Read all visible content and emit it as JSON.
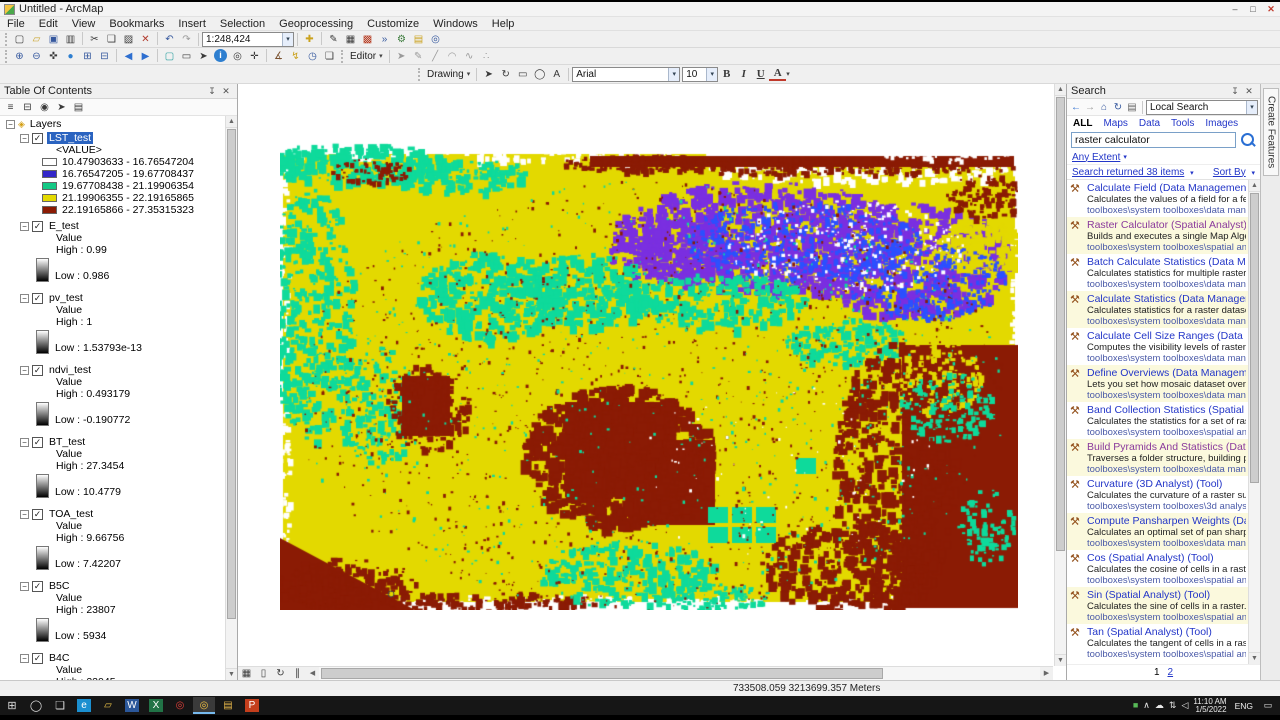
{
  "window": {
    "title": "Untitled - ArcMap",
    "controls": {
      "minimize": "–",
      "maximize": "□",
      "close": "✕"
    }
  },
  "ui": {
    "caret": "▾",
    "close": "✕",
    "pin": "↧",
    "check": "✓",
    "collapse": "−",
    "tool_glyph": "⚒",
    "arrow_left": "◀",
    "arrow_right": "▶",
    "arrow_up": "▲",
    "arrow_down": "▼",
    "layers_glyph": "◈"
  },
  "menubar": [
    "File",
    "Edit",
    "View",
    "Bookmarks",
    "Insert",
    "Selection",
    "Geoprocessing",
    "Customize",
    "Windows",
    "Help"
  ],
  "toolbars": {
    "scale_value": "1:248,424",
    "standard_left": [
      {
        "name": "new-map-icon",
        "glyph": "▢"
      },
      {
        "name": "open-icon",
        "glyph": "▱",
        "fg": "#c9a227"
      },
      {
        "name": "save-icon",
        "glyph": "▣",
        "fg": "#35589e"
      },
      {
        "name": "print-icon",
        "glyph": "▥"
      },
      {
        "sep": true
      },
      {
        "name": "cut-icon",
        "glyph": "✂"
      },
      {
        "name": "copy-icon",
        "glyph": "❑"
      },
      {
        "name": "paste-icon",
        "glyph": "▨"
      },
      {
        "name": "delete-icon",
        "glyph": "✕",
        "fg": "#b23b2e"
      },
      {
        "sep": true
      },
      {
        "name": "undo-icon",
        "glyph": "↶",
        "fg": "#35589e"
      },
      {
        "name": "redo-icon",
        "glyph": "↷",
        "fg": "#9a9a9a"
      }
    ],
    "standard_right": [
      {
        "name": "add-data-icon",
        "glyph": "✚",
        "fg": "#caa21e"
      },
      {
        "sep": true
      },
      {
        "name": "editor-toolbar-toggle-icon",
        "glyph": "✎"
      },
      {
        "name": "table-options-icon",
        "glyph": "▦"
      },
      {
        "name": "arctoolbox-icon",
        "glyph": "▩",
        "fg": "#b5391f"
      },
      {
        "name": "python-window-icon",
        "glyph": "»",
        "fg": "#35589e"
      },
      {
        "name": "model-builder-icon",
        "glyph": "⚙",
        "fg": "#3a7a3a"
      },
      {
        "name": "catalog-window-icon",
        "glyph": "▤",
        "fg": "#caa21e"
      },
      {
        "name": "search-window-icon",
        "glyph": "◎",
        "fg": "#35589e"
      }
    ],
    "tools": [
      {
        "name": "zoom-in-icon",
        "glyph": "⊕",
        "fg": "#35589e"
      },
      {
        "name": "zoom-out-icon",
        "glyph": "⊖",
        "fg": "#35589e"
      },
      {
        "name": "pan-icon",
        "glyph": "✜"
      },
      {
        "name": "full-extent-icon",
        "glyph": "●",
        "fg": "#2e7fd0"
      },
      {
        "name": "fixed-zoom-in-icon",
        "glyph": "⊞",
        "fg": "#35589e"
      },
      {
        "name": "fixed-zoom-out-icon",
        "glyph": "⊟",
        "fg": "#35589e"
      },
      {
        "sep": true
      },
      {
        "name": "back-extent-icon",
        "glyph": "◀",
        "fg": "#2e6fd0"
      },
      {
        "name": "forward-extent-icon",
        "glyph": "▶",
        "fg": "#2e6fd0"
      },
      {
        "sep": true
      },
      {
        "name": "select-features-icon",
        "glyph": "▢",
        "fg": "#2aa0a0"
      },
      {
        "name": "clear-selection-icon",
        "glyph": "▭"
      },
      {
        "name": "select-elements-icon",
        "glyph": "➤"
      },
      {
        "name": "identify-icon",
        "glyph": "i",
        "fg": "#ffffff",
        "bg": "#2e7fd0",
        "round": true
      },
      {
        "name": "find-icon",
        "glyph": "◎"
      },
      {
        "name": "go-to-xy-icon",
        "glyph": "✛"
      },
      {
        "sep": true
      },
      {
        "name": "measure-icon",
        "glyph": "∡",
        "fg": "#7a5230"
      },
      {
        "name": "hyperlink-icon",
        "glyph": "↯",
        "fg": "#caa21e"
      },
      {
        "name": "time-slider-icon",
        "glyph": "◷",
        "fg": "#35589e"
      },
      {
        "name": "viewer-window-icon",
        "glyph": "❏"
      }
    ],
    "editor_label": "Editor",
    "editor_icons": [
      {
        "name": "edit-tool-icon",
        "glyph": "➤"
      },
      {
        "name": "edit-sketch-icon",
        "glyph": "✎"
      },
      {
        "name": "straight-segment-icon",
        "glyph": "╱"
      },
      {
        "name": "arc-segment-icon",
        "glyph": "◠"
      },
      {
        "name": "trace-icon",
        "glyph": "∿"
      },
      {
        "name": "edit-vertices-icon",
        "glyph": "∴"
      }
    ],
    "drawing_label": "Drawing",
    "drawing_icons": [
      {
        "name": "select-elements-tool-icon",
        "glyph": "➤"
      },
      {
        "name": "rotate-element-icon",
        "glyph": "↻"
      },
      {
        "name": "rectangle-tool-icon",
        "glyph": "▭"
      },
      {
        "name": "circle-tool-icon",
        "glyph": "◯"
      },
      {
        "name": "text-tool-icon",
        "glyph": "A"
      }
    ],
    "font_name": "Arial",
    "font_size": "10",
    "style_buttons": [
      "B",
      "I",
      "U"
    ],
    "font_color_label": "A"
  },
  "toc": {
    "title": "Table Of Contents",
    "toolbar_icons": [
      {
        "name": "list-by-drawing-order-icon",
        "glyph": "≡"
      },
      {
        "name": "list-by-source-icon",
        "glyph": "⊟"
      },
      {
        "name": "list-by-visibility-icon",
        "glyph": "◉"
      },
      {
        "name": "list-by-selection-icon",
        "glyph": "➤"
      },
      {
        "name": "toc-options-icon",
        "glyph": "▤"
      }
    ],
    "root_label": "Layers",
    "layers": [
      {
        "name": "LST_test",
        "selected": true,
        "heading": "<VALUE>",
        "classes": [
          {
            "color": "#FFFFFF",
            "label": "10.47903633 - 16.76547204"
          },
          {
            "color": "#3327C9",
            "label": "16.76547205 - 19.67708437"
          },
          {
            "color": "#14C985",
            "label": "19.67708438 - 21.19906354"
          },
          {
            "color": "#E4DA00",
            "label": "21.19906355 - 22.19165865"
          },
          {
            "color": "#8B1B04",
            "label": "22.19165866 - 27.35315323"
          }
        ]
      },
      {
        "name": "E_test",
        "heading": "Value",
        "high": "High : 0.99",
        "low": "Low : 0.986"
      },
      {
        "name": "pv_test",
        "heading": "Value",
        "high": "High : 1",
        "low": "Low : 1.53793e-13"
      },
      {
        "name": "ndvi_test",
        "heading": "Value",
        "high": "High : 0.493179",
        "low": "Low : -0.190772"
      },
      {
        "name": "BT_test",
        "heading": "Value",
        "high": "High : 27.3454",
        "low": "Low : 10.4779"
      },
      {
        "name": "TOA_test",
        "heading": "Value",
        "high": "High : 9.66756",
        "low": "Low : 7.42207"
      },
      {
        "name": "B5C",
        "heading": "Value",
        "high": "High : 23807",
        "low": "Low : 5934"
      },
      {
        "name": "B4C",
        "heading": "Value",
        "high": "High : 22045",
        "low": null
      }
    ]
  },
  "map": {
    "palette": {
      "yellow": "#E3D900",
      "green": "#0EDA9B",
      "maroon": "#8B1B04",
      "purple": "#7A2FE0",
      "blue": "#2B50FF",
      "white": "#FFFFFF"
    }
  },
  "map_view_buttons": [
    {
      "name": "data-view-button",
      "glyph": "▦"
    },
    {
      "name": "layout-view-button",
      "glyph": "▯"
    },
    {
      "name": "refresh-view-button",
      "glyph": "↻"
    },
    {
      "name": "pause-drawing-button",
      "glyph": "∥"
    }
  ],
  "search": {
    "title": "Search",
    "nav_icons": [
      {
        "name": "search-back-icon",
        "glyph": "←",
        "fg": "#2e6fd0"
      },
      {
        "name": "search-forward-icon",
        "glyph": "→",
        "fg": "#9a9a9a"
      },
      {
        "name": "search-home-icon",
        "glyph": "⌂",
        "fg": "#35589e"
      },
      {
        "name": "search-refresh-icon",
        "glyph": "↻",
        "fg": "#35589e"
      },
      {
        "name": "search-index-icon",
        "glyph": "▤",
        "fg": "#666666"
      }
    ],
    "scope_value": "Local Search",
    "tabs": [
      {
        "label": "ALL",
        "active": true
      },
      {
        "label": "Maps"
      },
      {
        "label": "Data"
      },
      {
        "label": "Tools"
      },
      {
        "label": "Images"
      }
    ],
    "query": "raster calculator",
    "extent_label": "Any Extent",
    "returned_label": "Search returned 38 items",
    "sort_label": "Sort By",
    "results": [
      {
        "title": "Calculate Field (Data Management) (...",
        "desc": "Calculates the values of a field for a feat...",
        "path": "toolboxes\\system toolboxes\\data manag..."
      },
      {
        "title": "Raster Calculator (Spatial Analyst) (...",
        "desc": "Builds and executes a single Map Algebr...",
        "path": "toolboxes\\system toolboxes\\spatial anal...",
        "visited": true
      },
      {
        "title": "Batch Calculate Statistics (Data Man...",
        "desc": "Calculates statistics for multiple raster ...",
        "path": "toolboxes\\system toolboxes\\data manag..."
      },
      {
        "title": "Calculate Statistics (Data Manageme...",
        "desc": "Calculates statistics for a raster dataset...",
        "path": "toolboxes\\system toolboxes\\data manag..."
      },
      {
        "title": "Calculate Cell Size Ranges (Data Ma...",
        "desc": "Computes the visibility levels of raster ...",
        "path": "toolboxes\\system toolboxes\\data manag..."
      },
      {
        "title": "Define Overviews (Data Managemen...",
        "desc": "Lets you set how mosaic dataset overvie...",
        "path": "toolboxes\\system toolboxes\\data manag..."
      },
      {
        "title": "Band Collection Statistics (Spatial An...",
        "desc": "Calculates the statistics for a set of rast...",
        "path": "toolboxes\\system toolboxes\\spatial anal..."
      },
      {
        "title": "Build Pyramids And Statistics (Data M...",
        "desc": "Traverses a folder structure, building py...",
        "path": "toolboxes\\system toolboxes\\data manag...",
        "visited": true
      },
      {
        "title": "Curvature (3D Analyst) (Tool)",
        "desc": "Calculates the curvature of a raster sur...",
        "path": "toolboxes\\system toolboxes\\3d analyst t..."
      },
      {
        "title": "Compute Pansharpen Weights (Data...",
        "desc": "Calculates an optimal set of pan sharpe...",
        "path": "toolboxes\\system toolboxes\\data manag..."
      },
      {
        "title": "Cos (Spatial Analyst) (Tool)",
        "desc": "Calculates the cosine of cells in a raster.",
        "path": "toolboxes\\system toolboxes\\spatial anal..."
      },
      {
        "title": "Sin (Spatial Analyst) (Tool)",
        "desc": "Calculates the sine of cells in a raster.",
        "path": "toolboxes\\system toolboxes\\spatial anal..."
      },
      {
        "title": "Tan (Spatial Analyst) (Tool)",
        "desc": "Calculates the tangent of cells in a raster.",
        "path": "toolboxes\\system toolboxes\\spatial anal..."
      }
    ],
    "pagination": [
      {
        "label": "1",
        "current": true
      },
      {
        "label": "2"
      }
    ]
  },
  "create_features_label": "Create Features",
  "statusbar": {
    "coordinates": "733508.059  3213699.357 Meters"
  },
  "taskbar": {
    "start_glyph": "⊞",
    "cortana_glyph": "◯",
    "taskview_glyph": "❏",
    "apps": [
      {
        "name": "edge-icon",
        "glyph": "e",
        "bg": "#1b8fd0",
        "fg": "#ffffff"
      },
      {
        "name": "file-explorer-icon",
        "glyph": "▱",
        "fg": "#f3c94a"
      },
      {
        "name": "word-icon",
        "glyph": "W",
        "bg": "#2b579a",
        "fg": "#ffffff"
      },
      {
        "name": "excel-icon",
        "glyph": "X",
        "bg": "#217346",
        "fg": "#ffffff"
      },
      {
        "name": "chrome-icon",
        "glyph": "◎",
        "fg": "#e4403a"
      },
      {
        "name": "arcmap-icon",
        "glyph": "◎",
        "fg": "#f5c542",
        "active": true
      },
      {
        "name": "arccatalog-icon",
        "glyph": "▤",
        "fg": "#e8b84a"
      },
      {
        "name": "powerpoint-icon",
        "glyph": "P",
        "bg": "#c43e1c",
        "fg": "#ffffff"
      }
    ],
    "tray": [
      {
        "name": "tray-app-icon",
        "glyph": "■",
        "fg": "#57b957"
      },
      {
        "name": "hidden-icons-chevron",
        "glyph": "∧",
        "fg": "#e8e8e8"
      },
      {
        "name": "onedrive-icon",
        "glyph": "☁",
        "fg": "#e8e8e8"
      },
      {
        "name": "network-icon",
        "glyph": "⇅",
        "fg": "#e8e8e8"
      },
      {
        "name": "volume-icon",
        "glyph": "◁",
        "fg": "#e8e8e8"
      }
    ],
    "time": "11:10 AM",
    "date": "1/5/2022",
    "lang": "ENG",
    "notification_glyph": "▭"
  }
}
